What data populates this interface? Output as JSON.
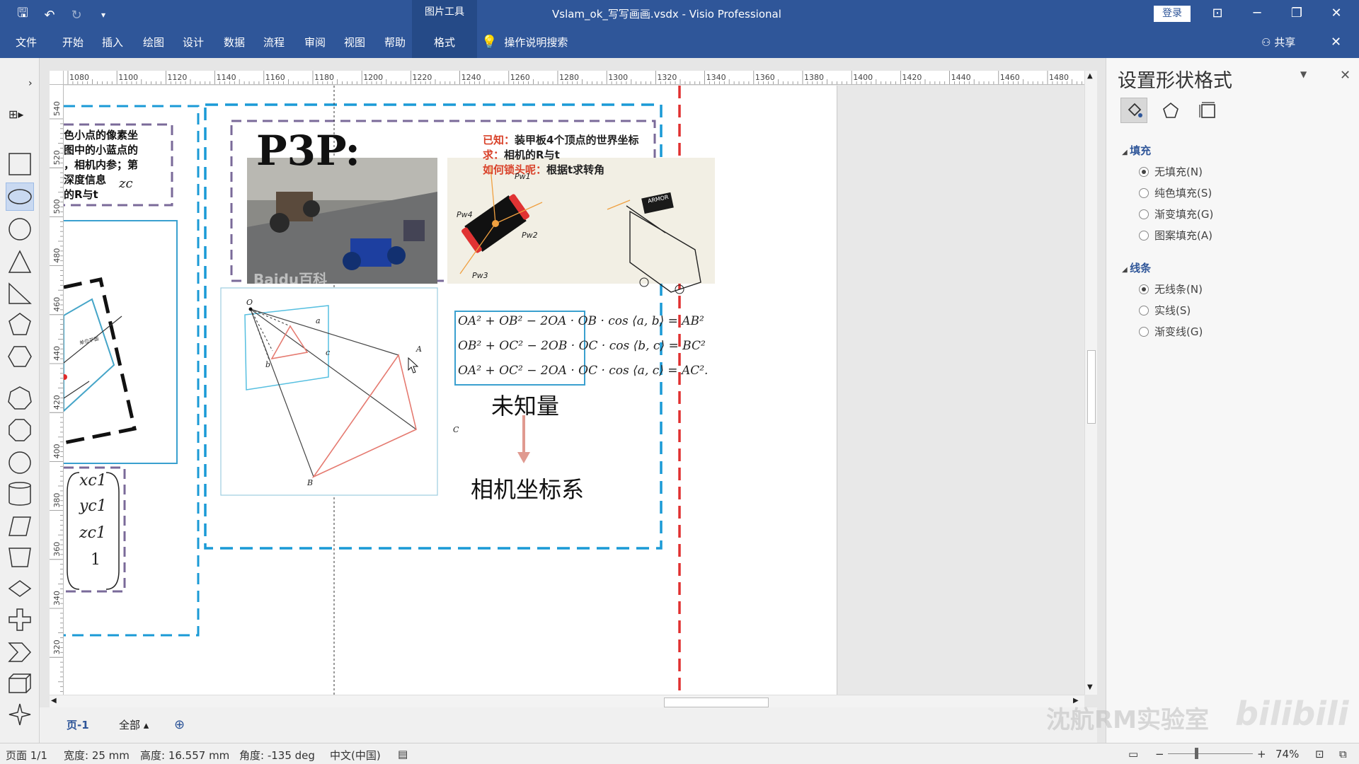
{
  "window": {
    "context_tab_title": "图片工具",
    "doc_title": "Vslam_ok_写写画画.vsdx - Visio Professional",
    "login": "登录",
    "minimize": "─",
    "restore": "❐",
    "close": "✕",
    "ribbon_display": "⊡"
  },
  "ribbon": {
    "tabs": [
      "文件",
      "开始",
      "插入",
      "绘图",
      "设计",
      "数据",
      "流程",
      "审阅",
      "视图",
      "帮助",
      "格式"
    ],
    "active_tab": "格式",
    "tell_me": "操作说明搜索",
    "share": "共享"
  },
  "ruler": {
    "h_labels": [
      "1080",
      "1100",
      "1120",
      "1140",
      "1160",
      "1180",
      "1200",
      "1220",
      "1240",
      "1260",
      "1280",
      "1300",
      "1320",
      "1340",
      "1360",
      "1380",
      "1400",
      "1420",
      "1440",
      "1460",
      "1480"
    ],
    "v_labels": [
      "540",
      "520",
      "500",
      "480",
      "460",
      "440",
      "420",
      "400",
      "380",
      "360",
      "340",
      "320"
    ]
  },
  "canvas": {
    "left_fragment_lines": [
      "色小点的像素坐",
      "图中的小蓝点的",
      "，相机内参；第",
      "深度信息",
      "的R与t"
    ],
    "zc_symbol": "zc",
    "matrix": [
      "xc1",
      "yc1",
      "zc1",
      "1"
    ],
    "p3p_title": "P3P:",
    "known_label": "已知：",
    "known_text": "装甲板4个顶点的世界坐标",
    "find_label": "求：",
    "find_text": "相机的R与t",
    "how_label": "如何锁头呢：",
    "how_text": "根据t求转角",
    "photo_watermark": "Baidu百科",
    "sketch_labels": [
      "Pw1",
      "Pw2",
      "Pw3",
      "Pw4"
    ],
    "sketch_car_label": "ARMOR",
    "diagram_labels": [
      "O",
      "a",
      "b",
      "c",
      "A",
      "B",
      "C"
    ],
    "diagram_inner_text": "单位平面",
    "equations": [
      "OA² + OB² − 2OA · OB · cos ⟨a, b⟩ = AB²",
      "OB² + OC² − 2OB · OC · cos ⟨b, c⟩ = BC²",
      "OA² + OC² − 2OA · OC · cos ⟨a, c⟩ = AC²."
    ],
    "unknown_label": "未知量",
    "camera_coord_label": "相机坐标系"
  },
  "pane": {
    "title": "设置形状格式",
    "fill_section": "填充",
    "fill_options": [
      "无填充(N)",
      "纯色填充(S)",
      "渐变填充(G)",
      "图案填充(A)"
    ],
    "line_section": "线条",
    "line_options": [
      "无线条(N)",
      "实线(S)",
      "渐变线(G)"
    ]
  },
  "page_tabs": {
    "page": "页-1",
    "all": "全部 ▴",
    "add": "⊕"
  },
  "status": {
    "page": "页面 1/1",
    "width": "宽度: 25 mm",
    "height": "高度: 16.557 mm",
    "angle": "角度: -135 deg",
    "language": "中文(中国)",
    "zoom": "74%",
    "zoom_minus": "−",
    "zoom_plus": "+"
  },
  "watermark": {
    "text": "沈航RM实验室",
    "logo": "bilibili"
  },
  "colors": {
    "title_bar": "#2f5699",
    "dash_blue": "#1a9ad6",
    "dash_purple": "#7a6a99",
    "dash_red": "#e03030",
    "text_red": "#d9422a",
    "arrow_pink": "#e09a90"
  }
}
